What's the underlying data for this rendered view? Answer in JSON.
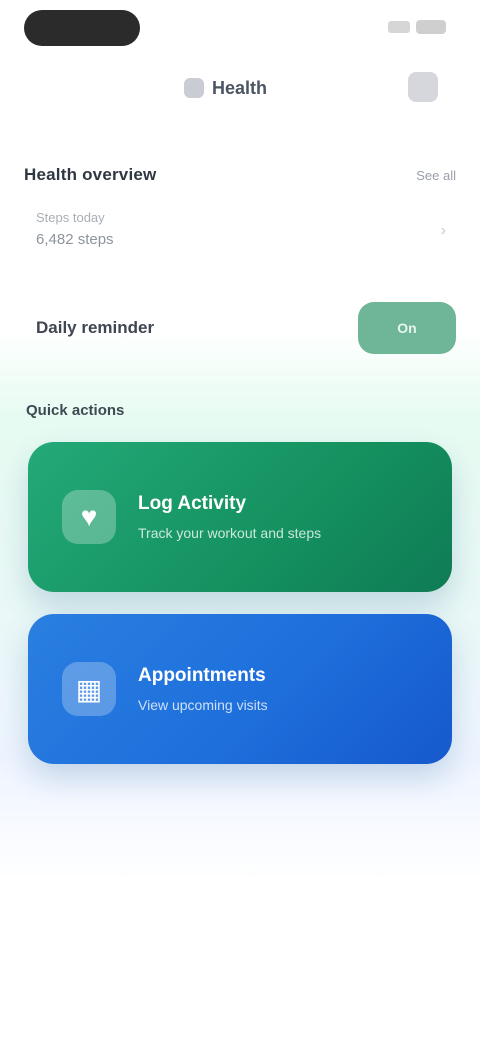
{
  "header": {
    "title": "Health",
    "title_icon": "heart-icon",
    "action_icon": "settings-icon"
  },
  "section": {
    "title": "Health overview",
    "link": "See all"
  },
  "info_row": {
    "label": "Steps today",
    "value": "6,482 steps"
  },
  "toggle_row": {
    "label": "Daily reminder",
    "button_label": "On"
  },
  "cards_section": {
    "title": "Quick actions"
  },
  "cards": [
    {
      "title": "Log Activity",
      "subtitle": "Track your workout and steps",
      "icon": "activity-icon",
      "color": "#1a9b6a"
    },
    {
      "title": "Appointments",
      "subtitle": "View upcoming visits",
      "icon": "calendar-icon",
      "color": "#1f6fdc"
    }
  ],
  "colors": {
    "accent_green": "#6fb597",
    "card_green": "#1a9b6a",
    "card_blue": "#1f6fdc"
  }
}
